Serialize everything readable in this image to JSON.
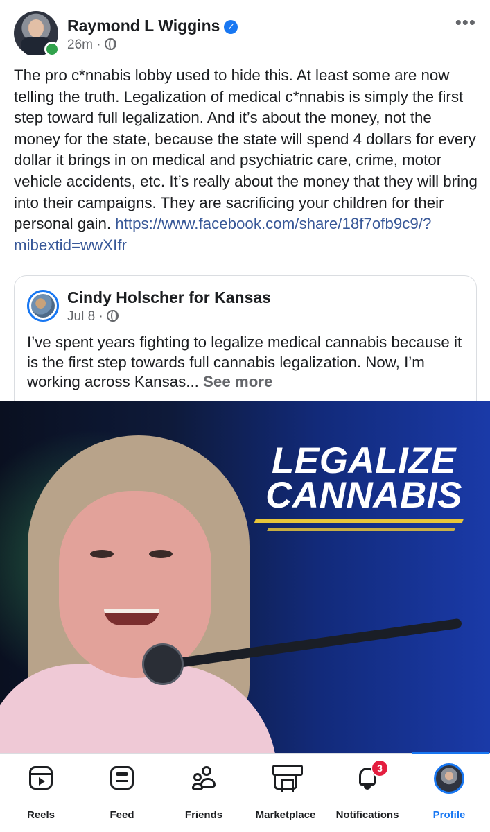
{
  "post": {
    "author": "Raymond L Wiggins",
    "time": "26m",
    "text": "The pro c*nnabis lobby used to hide this. At least some are now telling the truth. Legalization of medical c*nnabis is simply the first step toward full legalization. And it’s about the money, not the money for the state, because the state will spend 4 dollars for every dollar it brings in on medical and psychiatric care, crime, motor vehicle accidents, etc. It’s really about the money that they will bring into their campaigns. They are sacrificing your children for their personal gain. ",
    "link": "https://www.facebook.com/share/18f7ofb9c9/?mibextid=wwXIfr",
    "more_label": "•••"
  },
  "shared": {
    "author": "Cindy Holscher for Kansas",
    "time": "Jul 8",
    "text": "I’ve spent years fighting to legalize medical cannabis because it is the first step towards full cannabis legalization. Now, I’m working across Kansas... ",
    "see_more": "See more",
    "image_headline_line1": "LEGALIZE",
    "image_headline_line2": "CANNABIS"
  },
  "nav": {
    "items": [
      {
        "label": "Reels",
        "icon": "reels-icon"
      },
      {
        "label": "Feed",
        "icon": "feed-icon"
      },
      {
        "label": "Friends",
        "icon": "friends-icon"
      },
      {
        "label": "Marketplace",
        "icon": "marketplace-icon"
      },
      {
        "label": "Notifications",
        "icon": "bell-icon",
        "badge": "3"
      },
      {
        "label": "Profile",
        "icon": "profile-avatar",
        "active": true
      }
    ]
  },
  "colors": {
    "accent": "#1877f2",
    "link": "#385898",
    "badge": "#e41e3f",
    "online": "#31a24c",
    "headline_underline": "#e8c63a"
  }
}
